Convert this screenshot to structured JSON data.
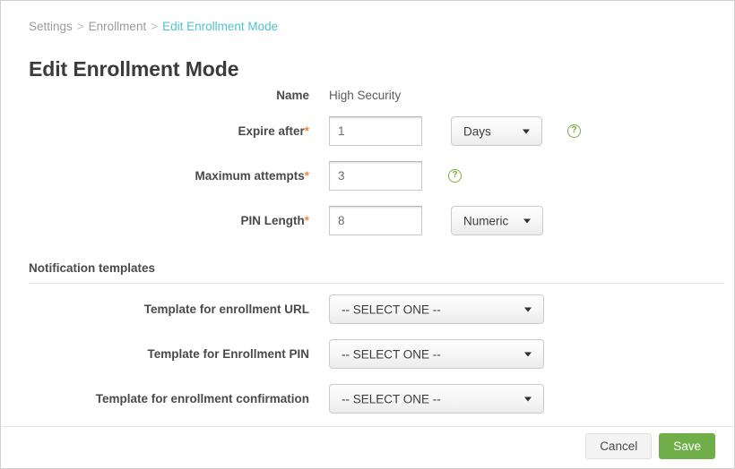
{
  "breadcrumb": {
    "items": [
      {
        "label": "Settings",
        "active": false
      },
      {
        "label": "Enrollment",
        "active": false
      },
      {
        "label": "Edit Enrollment Mode",
        "active": true
      }
    ],
    "separator": ">"
  },
  "page_title": "Edit Enrollment Mode",
  "form": {
    "name": {
      "label": "Name",
      "value": "High Security"
    },
    "expire_after": {
      "label": "Expire after",
      "required_marker": "*",
      "value": "1",
      "unit_value": "Days",
      "help_icon": "help-circle-icon",
      "help_glyph": "?"
    },
    "maximum_attempts": {
      "label": "Maximum attempts",
      "required_marker": "*",
      "value": "3",
      "help_icon": "help-circle-icon",
      "help_glyph": "?"
    },
    "pin_length": {
      "label": "PIN Length",
      "required_marker": "*",
      "value": "8",
      "type_value": "Numeric"
    }
  },
  "section": {
    "title": "Notification templates",
    "rows": [
      {
        "label": "Template for enrollment URL",
        "value": "-- SELECT ONE --"
      },
      {
        "label": "Template for Enrollment PIN",
        "value": "-- SELECT ONE --"
      },
      {
        "label": "Template for enrollment confirmation",
        "value": "-- SELECT ONE --"
      }
    ]
  },
  "footer": {
    "cancel_label": "Cancel",
    "save_label": "Save"
  },
  "colors": {
    "breadcrumb_active": "#4ec3c9",
    "breadcrumb_inactive": "#9b9b9b",
    "required_asterisk": "#f0893a",
    "help_icon": "#7aab3a",
    "save_button": "#6fae48",
    "label_text": "#4a4a4a"
  }
}
